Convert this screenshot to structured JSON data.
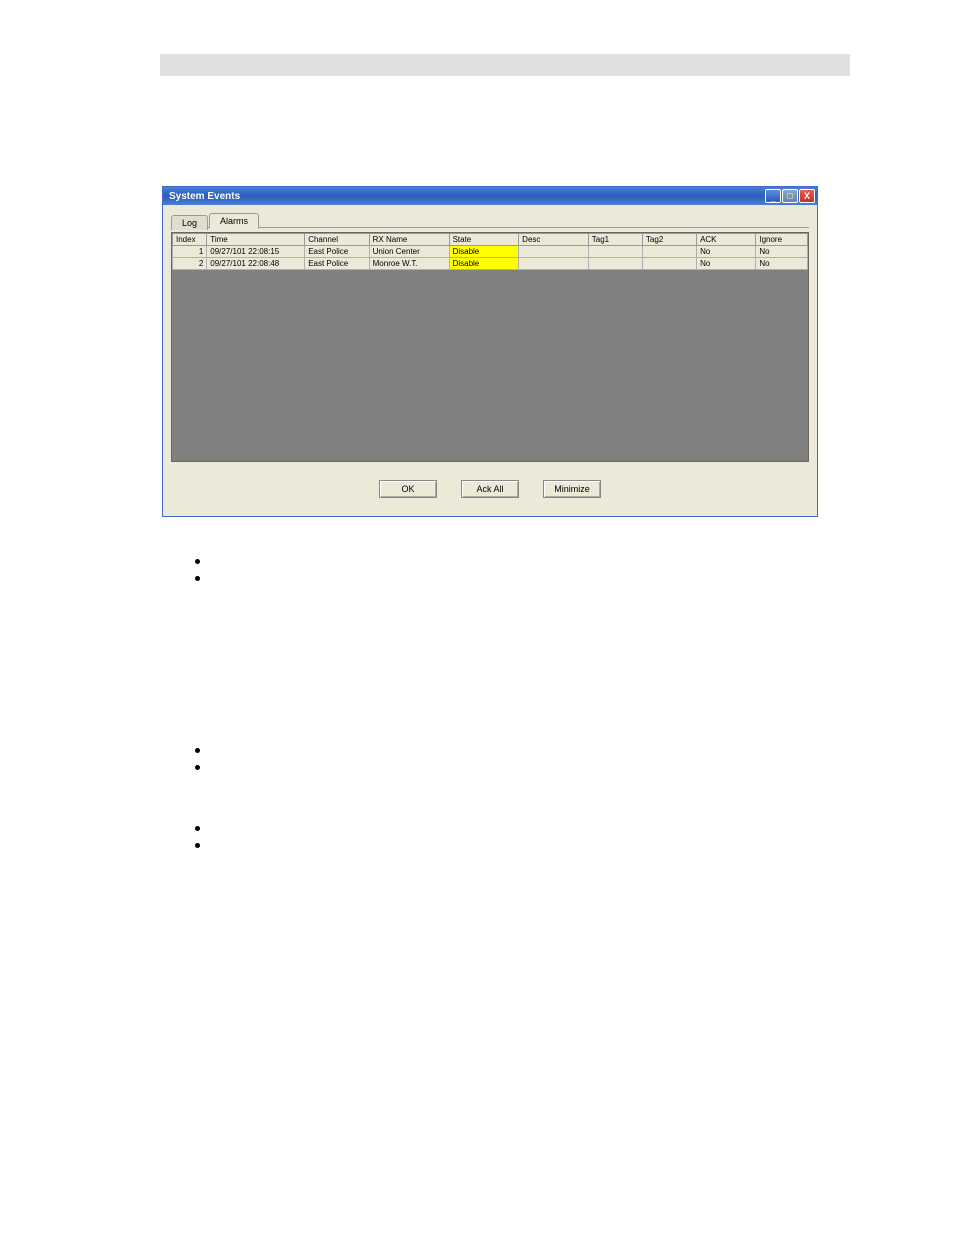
{
  "window": {
    "title": "System Events",
    "tabs": {
      "log": "Log",
      "alarms": "Alarms"
    },
    "columns": {
      "index": "Index",
      "time": "Time",
      "channel": "Channel",
      "rxname": "RX Name",
      "state": "State",
      "desc": "Desc",
      "tag1": "Tag1",
      "tag2": "Tag2",
      "ack": "ACK",
      "ignore": "Ignore"
    },
    "rows": [
      {
        "index": "1",
        "time": "09/27/101 22:08:15",
        "channel": "East Police",
        "rxname": "Union Center",
        "state": "Disable",
        "desc": "",
        "tag1": "",
        "tag2": "",
        "ack": "No",
        "ignore": "No"
      },
      {
        "index": "2",
        "time": "09/27/101 22:08:48",
        "channel": "East Police",
        "rxname": "Monroe W.T.",
        "state": "Disable",
        "desc": "",
        "tag1": "",
        "tag2": "",
        "ack": "No",
        "ignore": "No"
      }
    ],
    "buttons": {
      "ok": "OK",
      "ackall": "Ack All",
      "minimize": "Minimize"
    },
    "controls": {
      "min": "_",
      "max": "□",
      "close": "X"
    }
  }
}
